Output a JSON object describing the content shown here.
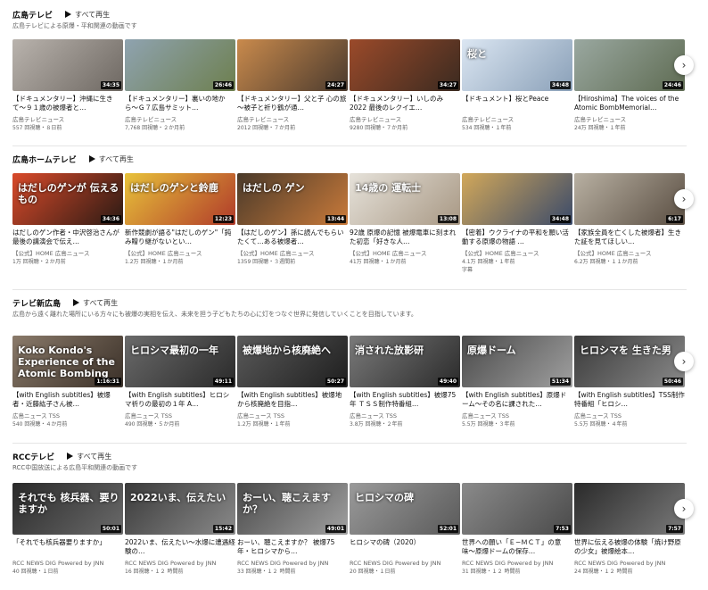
{
  "shelves": [
    {
      "title": "広島テレビ",
      "play_all": "すべて再生",
      "subtitle": "広島テレビによる原爆・平和関連の動画です",
      "videos": [
        {
          "thumb_text": "",
          "duration": "34:35",
          "title": "【ドキュメンタリー】沖縄に生きて〜９１歳の被爆者と…",
          "channel": "広島テレビニュース",
          "meta": "557 回視聴・８日前",
          "colors": [
            "#b9b3ad",
            "#6e6862"
          ]
        },
        {
          "thumb_text": "",
          "duration": "26:46",
          "title": "【ドキュメンタリー】裏いの地から〜Ｇ７広島サミット…",
          "channel": "広島テレビニュース",
          "meta": "7,768 回視聴・２か月前",
          "colors": [
            "#8fa3b0",
            "#6d7f4e"
          ]
        },
        {
          "thumb_text": "",
          "duration": "24:27",
          "title": "【ドキュメンタリー】父と子 心の旅 〜被子と祈り鶴が通…",
          "channel": "広島テレビニュース",
          "meta": "2012 回視聴・７か月前",
          "colors": [
            "#c98a4c",
            "#4a3a2e"
          ]
        },
        {
          "thumb_text": "",
          "duration": "34:27",
          "title": "【ドキュメンタリー】いしのみ2022 最後のレクイエ…",
          "channel": "広島テレビニュース",
          "meta": "9280 回視聴・７か月前",
          "colors": [
            "#9b4a2a",
            "#3a2a20"
          ]
        },
        {
          "thumb_text": "桜と",
          "duration": "34:48",
          "title": "【ドキュメント】桜とPeace",
          "channel": "広島テレビニュース",
          "meta": "534 回視聴・１年前",
          "colors": [
            "#dbe6f2",
            "#8aa0b8"
          ]
        },
        {
          "thumb_text": "",
          "duration": "24:46",
          "title": "【Hiroshima】The voices of the Atomic BombMemorial…",
          "channel": "広島テレビニュース",
          "meta": "24万 回視聴・１年前",
          "colors": [
            "#9aa8a0",
            "#5e6b52"
          ]
        }
      ]
    },
    {
      "title": "広島ホームテレビ",
      "play_all": "すべて再生",
      "subtitle": "",
      "videos": [
        {
          "thumb_text": "はだしのゲンが 伝えるもの",
          "duration": "34:36",
          "title": "はだしのゲン作者・中沢啓治さんが最後の講演会で伝え…",
          "channel": "【公式】HOME 広島ニュース",
          "meta": "1万 回視聴・２か月前",
          "colors": [
            "#d94a2a",
            "#2a1a14"
          ]
        },
        {
          "thumb_text": "はだしのゲンと鈴鹿",
          "duration": "12:23",
          "title": "新作競劇が語る\"はだしのゲン\"「鈍み贈り継がないとい…",
          "channel": "【公式】HOME 広島ニュース",
          "meta": "1.2万 回視聴・１か月前",
          "colors": [
            "#e8c23a",
            "#b03a2a"
          ]
        },
        {
          "thumb_text": "はだしの ゲン",
          "duration": "13:44",
          "title": "【はだしのゲン】孫に読んでもらいたくて…ある被爆者…",
          "channel": "【公式】HOME 広島ニュース",
          "meta": "1359 回視聴・３週間前",
          "colors": [
            "#4a3a2a",
            "#c97a3a"
          ]
        },
        {
          "thumb_text": "14歳の 運転士",
          "duration": "13:08",
          "title": "92歳 原爆の記憶 被爆電車に刻まれた初恋「好きな人…",
          "channel": "【公式】HOME 広島ニュース",
          "meta": "41万 回視聴・１か月前",
          "colors": [
            "#e6e2da",
            "#a89884"
          ]
        },
        {
          "thumb_text": "",
          "duration": "34:48",
          "title": "【密着】ウクライナの平和を願い活動する原爆の物語 …",
          "channel": "【公式】HOME 広島ニュース",
          "meta": "4.1万 回視聴・１年前",
          "extra": "字幕",
          "colors": [
            "#d2a85a",
            "#3a4a6a"
          ]
        },
        {
          "thumb_text": "",
          "duration": "6:17",
          "title": "【家族全員を亡くした被爆者】生きた証を見てほしい…",
          "channel": "【公式】HOME 広島ニュース",
          "meta": "6.2万 回視聴・１１か月前",
          "colors": [
            "#b8b0a2",
            "#5a4e42"
          ]
        }
      ]
    },
    {
      "title": "テレビ新広島",
      "play_all": "すべて再生",
      "subtitle": "広島から遠く離れた場所にいる方々にも被爆の実相を伝え、未来を担う子どもたちの心に灯をつなぐ世界に発信していくことを目指しています。",
      "videos": [
        {
          "thumb_text": "Koko Kondo's Experience of the Atomic Bombing",
          "duration": "1:16:31",
          "title": "【with English subtitles】被爆者・近藤紘子さん被…",
          "channel": "広島ニュース TSS",
          "meta": "540 回視聴・４か月前",
          "colors": [
            "#8a7a6a",
            "#3a3028"
          ]
        },
        {
          "thumb_text": "ヒロシマ最初の一年",
          "duration": "49:11",
          "title": "【with English subtitles】ヒロシマ祈りの最初の１年 A…",
          "channel": "広島ニュース TSS",
          "meta": "490 回視聴・５か月前",
          "colors": [
            "#6a6a6a",
            "#2a2a2a"
          ]
        },
        {
          "thumb_text": "被爆地から核廃絶へ",
          "duration": "50:27",
          "title": "【with English subtitles】被爆地から核廃絶を目指…",
          "channel": "広島ニュース TSS",
          "meta": "1.2万 回視聴・１年前",
          "colors": [
            "#5a5a5a",
            "#1e1e1e"
          ]
        },
        {
          "thumb_text": "消された放影研",
          "duration": "49:40",
          "title": "【with English subtitles】被爆75年 ＴＳＳ制作特番組…",
          "channel": "広島ニュース TSS",
          "meta": "3.8万 回視聴・２年前",
          "colors": [
            "#7a7a7a",
            "#2a2a2a"
          ]
        },
        {
          "thumb_text": "原爆ドーム",
          "duration": "51:34",
          "title": "【with English subtitles】原爆ドーム〜その名に課された…",
          "channel": "広島ニュース TSS",
          "meta": "5.5万 回視聴・３年前",
          "colors": [
            "#4a4a4a",
            "#a0a0a0"
          ]
        },
        {
          "thumb_text": "ヒロシマを 生きた男",
          "duration": "50:46",
          "title": "【with English subtitles】TSS制作特番組「ヒロシ…",
          "channel": "広島ニュース TSS",
          "meta": "5.5万 回視聴・４年前",
          "colors": [
            "#3a3a3a",
            "#8a8a8a"
          ]
        }
      ]
    },
    {
      "title": "RCCテレビ",
      "play_all": "すべて再生",
      "subtitle": "RCC中国放送による広島平和関連の動画です",
      "videos": [
        {
          "thumb_text": "それでも 核兵器、要りますか",
          "duration": "50:01",
          "title": "「それでも核兵器要りますか」",
          "channel": "RCC NEWS DIG Powered by JNN",
          "meta": "40 回視聴・１日前",
          "colors": [
            "#2a2a2a",
            "#6a6a6a"
          ]
        },
        {
          "thumb_text": "2022いま、伝えたい",
          "duration": "15:42",
          "title": "2022いま、伝えたい〜水爆に遭遇経験の…",
          "channel": "RCC NEWS DIG Powered by JNN",
          "meta": "16 回視聴・１２ 時間前",
          "colors": [
            "#3a3a3a",
            "#8a8a8a"
          ]
        },
        {
          "thumb_text": "おーい、聴こえますか？",
          "duration": "49:01",
          "title": "おーい、聴こえますか？ 被爆75年・ヒロシマから…",
          "channel": "RCC NEWS DIG Powered by JNN",
          "meta": "33 回視聴・１２ 時間前",
          "colors": [
            "#4a4a4a",
            "#a0a0a0"
          ]
        },
        {
          "thumb_text": "ヒロシマの碑",
          "duration": "52:01",
          "title": "ヒロシマの碑（2020）",
          "channel": "RCC NEWS DIG Powered by JNN",
          "meta": "20 回視聴・１日前",
          "colors": [
            "#9a9a9a",
            "#5a5a5a"
          ]
        },
        {
          "thumb_text": "",
          "duration": "7:53",
          "title": "世界への願い「Ｅ−ＭＣＴ」の意味〜原爆ドームの保存…",
          "channel": "RCC NEWS DIG Powered by JNN",
          "meta": "31 回視聴・１２ 時間前",
          "colors": [
            "#8a8a8a",
            "#4a4a4a"
          ]
        },
        {
          "thumb_text": "",
          "duration": "7:57",
          "title": "世界に伝える被爆の体験「焼け野原の少女」被爆絵本…",
          "channel": "RCC NEWS DIG Powered by JNN",
          "meta": "24 回視聴・１２ 時間前",
          "colors": [
            "#2a2a2a",
            "#7a7a7a"
          ]
        }
      ]
    }
  ],
  "next_button_icon": "chevron-right-icon",
  "next_button_glyph": "›"
}
